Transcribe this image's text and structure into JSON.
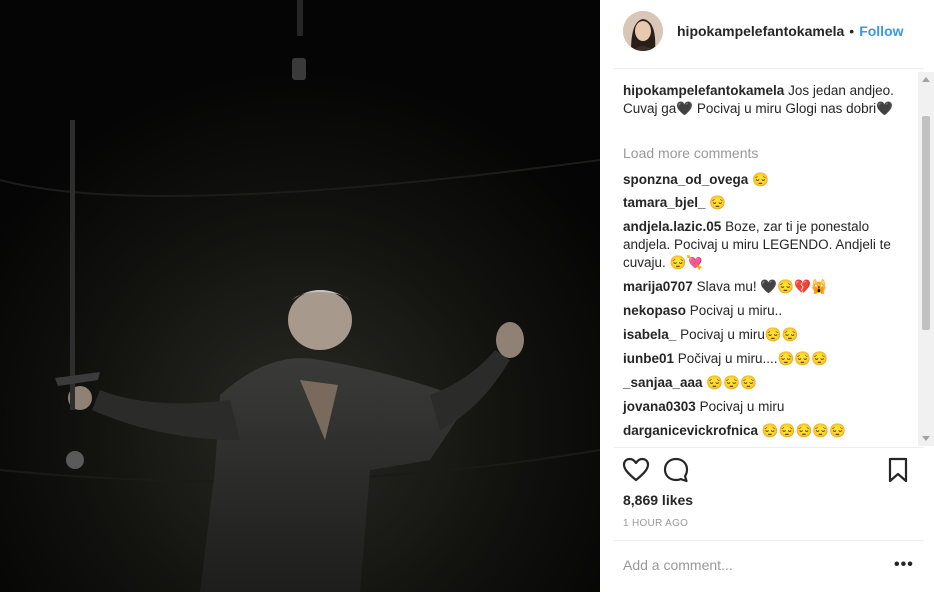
{
  "header": {
    "username": "hipokampelefantokamela",
    "separator": "•",
    "follow_label": "Follow"
  },
  "caption": {
    "user": "hipokampelefantokamela",
    "text": "Jos jedan andjeo. Cuvaj ga🖤 Pocivaj u miru Glogi nas dobri🖤"
  },
  "load_more_label": "Load more comments",
  "comments": [
    {
      "user": "sponzna_od_ovega",
      "text": "😔"
    },
    {
      "user": "tamara_bjel_",
      "text": "😔"
    },
    {
      "user": "andjela.lazic.05",
      "text": "Boze, zar ti je ponestalo andjela. Pocivaj u miru LEGENDO. Andjeli te cuvaju. 😔💘"
    },
    {
      "user": "marija0707",
      "text": "Slava mu! 🖤😔💔🙀"
    },
    {
      "user": "nekopaso",
      "text": "Pocivaj u miru.."
    },
    {
      "user": "isabela_",
      "text": "Pocivaj u miru😔😔"
    },
    {
      "user": "iunbe01",
      "text": "Počivaj u miru....😔😔😔"
    },
    {
      "user": "_sanjaa_aaa",
      "text": "😔😔😔"
    },
    {
      "user": "jovana0303",
      "text": "Pocivaj u miru"
    },
    {
      "user": "darganicevickrofnica",
      "text": "😔😔😔😔😔"
    }
  ],
  "likes_label": "8,869 likes",
  "time_label": "1 HOUR AGO",
  "comment_input": {
    "placeholder": "Add a comment..."
  },
  "more_label": "•••",
  "colors": {
    "follow": "#3897f0",
    "text": "#262626",
    "muted": "#999999",
    "divider": "#efefef"
  },
  "icons": {
    "like": "heart-icon",
    "comment": "speech-bubble-icon",
    "save": "bookmark-icon",
    "more": "more-options-icon"
  }
}
